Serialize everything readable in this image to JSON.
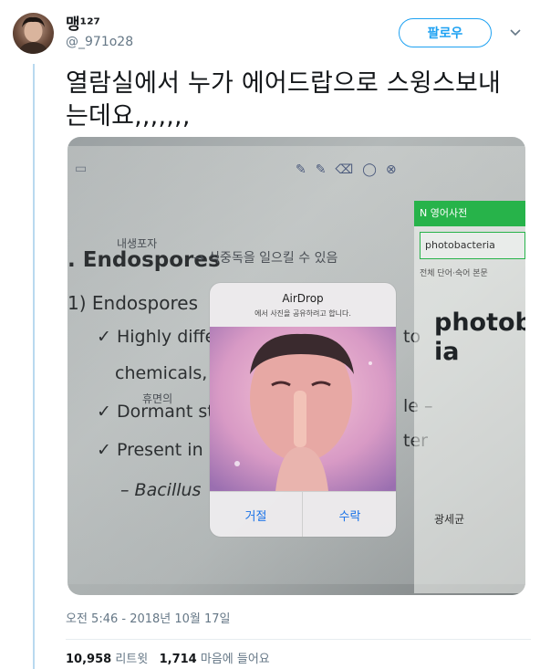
{
  "user": {
    "name": "맹¹²⁷",
    "handle": "@_971o28"
  },
  "actions": {
    "follow_label": "팔로우"
  },
  "tweet": {
    "text": "열람실에서 누가 에어드랍으로 스윙스보내는데요,,,,,,,"
  },
  "photo": {
    "slide": {
      "heading": ". Endospores",
      "heading_note": "→ 식중독을 일으킬 수 있음",
      "heading_hand": "내생포자",
      "line_item": "1)  Endospores",
      "bullet1": "✓ Highly diffe",
      "bullet1_right": "to",
      "line_chem": "chemicals,",
      "bullet2": "✓ Dormant st",
      "bullet2_hand": "휴면의",
      "bullet2_right": "le –",
      "bullet3": "✓ Present in",
      "bullet3_right": "ter",
      "sub": "–   Bacillus"
    },
    "dictionary": {
      "header": "N  영어사전",
      "query": "photobacteria",
      "tabs": "전체    단어·숙어    본문",
      "result": "photoba ia",
      "side_label": "광세균"
    },
    "airdrop": {
      "title": "AirDrop",
      "message": "에서 사진을 공유하려고 합니다.",
      "decline_label": "거절",
      "accept_label": "수락"
    }
  },
  "meta": {
    "timestamp": "오전 5:46 - 2018년 10월 17일",
    "retweets_count": "10,958",
    "retweets_label": "리트윗",
    "likes_count": "1,714",
    "likes_label": "마음에 들어요"
  },
  "colors": {
    "accent": "#1da1f2",
    "thread_line": "#b9d9ef",
    "muted": "#657786"
  }
}
